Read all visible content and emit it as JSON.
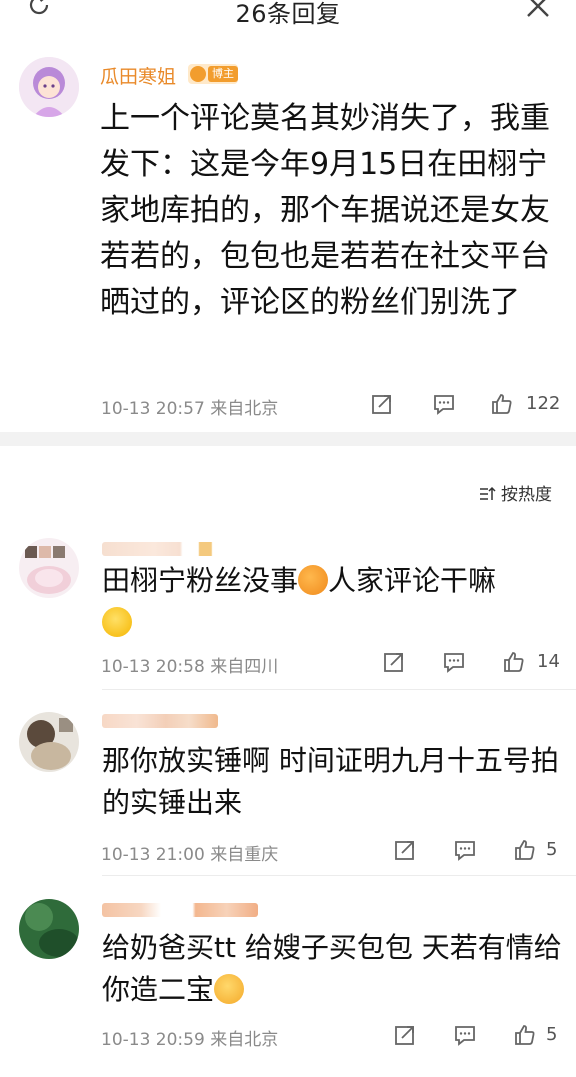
{
  "header": {
    "title": "26条回复"
  },
  "main_post": {
    "author": "瓜田寒姐",
    "badge": "博主",
    "content": "上一个评论莫名其妙消失了，我重发下：这是今年9月15日在田栩宁家地库拍的，那个车据说还是女友若若的，包包也是若若在社交平台晒过的，评论区的粉丝们别洗了",
    "time": "10-13 20:57",
    "location": "来自北京",
    "likes": "122"
  },
  "sort": {
    "label": "按热度"
  },
  "comments": [
    {
      "text_a": "田栩宁粉丝没事",
      "text_b": "人家评论干嘛",
      "time": "10-13 20:58",
      "location": "来自四川",
      "likes": "14"
    },
    {
      "text": "那你放实锤啊 时间证明九月十五号拍的实锤出来",
      "time": "10-13 21:00",
      "location": "来自重庆",
      "likes": "5"
    },
    {
      "text_a": "给奶爸买tt 给嫂子买包包 天若有情给你造二宝",
      "time": "10-13 20:59",
      "location": "来自北京",
      "likes": "5"
    }
  ],
  "colors": {
    "author_name": "#e98a2a",
    "meta_text": "#8a8a8a",
    "divider_band": "#f2f2f2"
  },
  "icons": {
    "refresh": "refresh-icon",
    "close": "close-icon",
    "share": "share-icon",
    "comment": "comment-icon",
    "like": "thumbs-up-icon",
    "sort": "sort-icon"
  }
}
